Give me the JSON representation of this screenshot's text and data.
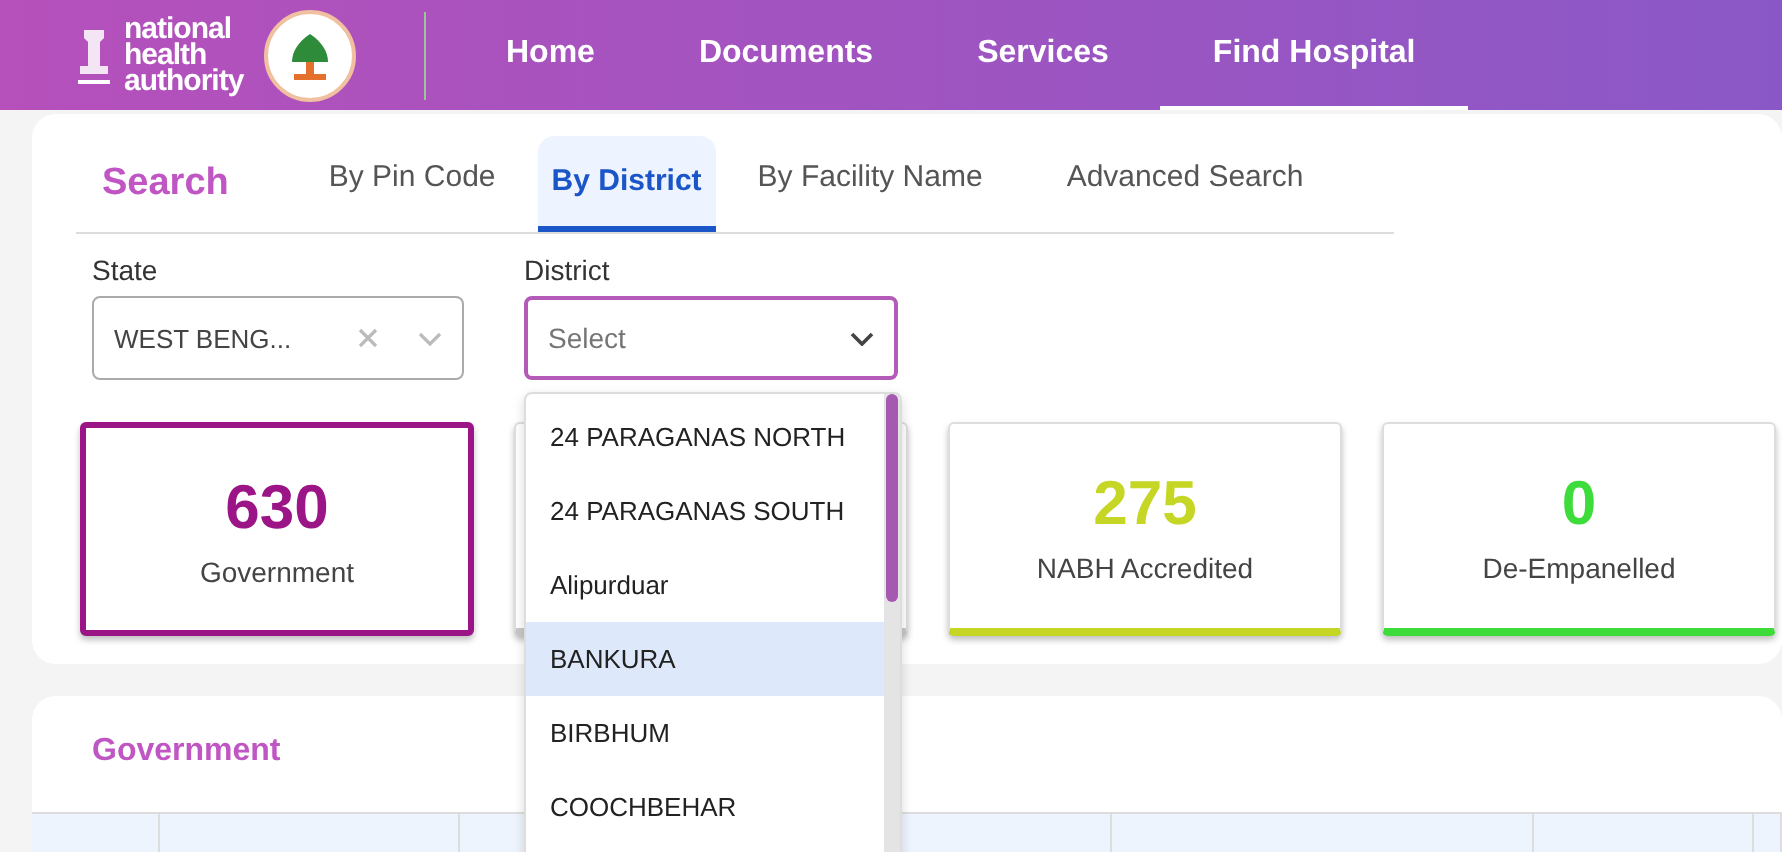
{
  "header": {
    "logo_text": "national health authority",
    "nav": [
      {
        "label": "Home",
        "selected": false
      },
      {
        "label": "Documents",
        "selected": false
      },
      {
        "label": "Services",
        "selected": false
      },
      {
        "label": "Find Hospital",
        "selected": true
      }
    ]
  },
  "search": {
    "title": "Search",
    "tabs": [
      {
        "label": "By Pin Code",
        "selected": false
      },
      {
        "label": "By District",
        "selected": true
      },
      {
        "label": "By Facility Name",
        "selected": false
      },
      {
        "label": "Advanced Search",
        "selected": false
      }
    ],
    "state_field": {
      "label": "State",
      "value": "WEST BENG..."
    },
    "district_field": {
      "label": "District",
      "placeholder": "Select",
      "expanded": true,
      "options": [
        {
          "label": "24 PARAGANAS NORTH",
          "selected": false
        },
        {
          "label": "24 PARAGANAS SOUTH",
          "selected": false
        },
        {
          "label": "Alipurduar",
          "selected": false
        },
        {
          "label": "BANKURA",
          "selected": true
        },
        {
          "label": "BIRBHUM",
          "selected": false
        },
        {
          "label": "COOCHBEHAR",
          "selected": false
        }
      ]
    }
  },
  "stats": [
    {
      "count": "630",
      "label": "Government",
      "color": "#9c1586",
      "selected": true
    },
    {
      "selected": false
    },
    {
      "count": "275",
      "label": "NABH Accredited",
      "color": "#c5d624",
      "selected": false
    },
    {
      "count": "0",
      "label": "De-Empanelled",
      "color": "#3ddc3a",
      "selected": false
    }
  ],
  "results": {
    "title": "Government"
  }
}
